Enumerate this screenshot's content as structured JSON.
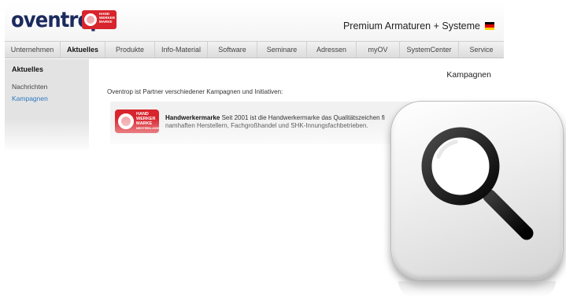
{
  "site": {
    "logo_text": "oventrop",
    "badge_lines": [
      "HAND",
      "WERKER",
      "MARKE",
      "MEISTERKLASSE"
    ],
    "tagline": "Premium Armaturen + Systeme",
    "flag_colors": [
      "#000000",
      "#dd0000",
      "#ffce00"
    ],
    "nav": [
      "Unternehmen",
      "Aktuelles",
      "Produkte",
      "Info-Material",
      "Software",
      "Seminare",
      "Adressen",
      "myOV",
      "SystemCenter",
      "Service"
    ],
    "nav_active": "Aktuelles",
    "sidebar": {
      "title": "Aktuelles",
      "items": [
        "Nachrichten",
        "Kampagnen"
      ],
      "current": "Kampagnen"
    },
    "page_heading": "Kampagnen",
    "intro": "Oventrop ist Partner verschiedener Kampagnen und Initiativen:",
    "teaser": {
      "title": "Handwerkermarke",
      "line1": " Seit 2001 ist die Handwerkermarke das Qualitätszeichen fi",
      "line2": "namhaften Herstellern, Fachgroßhandel und SHK-Innungsfachbetrieben."
    },
    "link_color": "#2e78c2",
    "brand_red": "#d8242c"
  },
  "overlay": {
    "icon": "magnifier-icon"
  }
}
